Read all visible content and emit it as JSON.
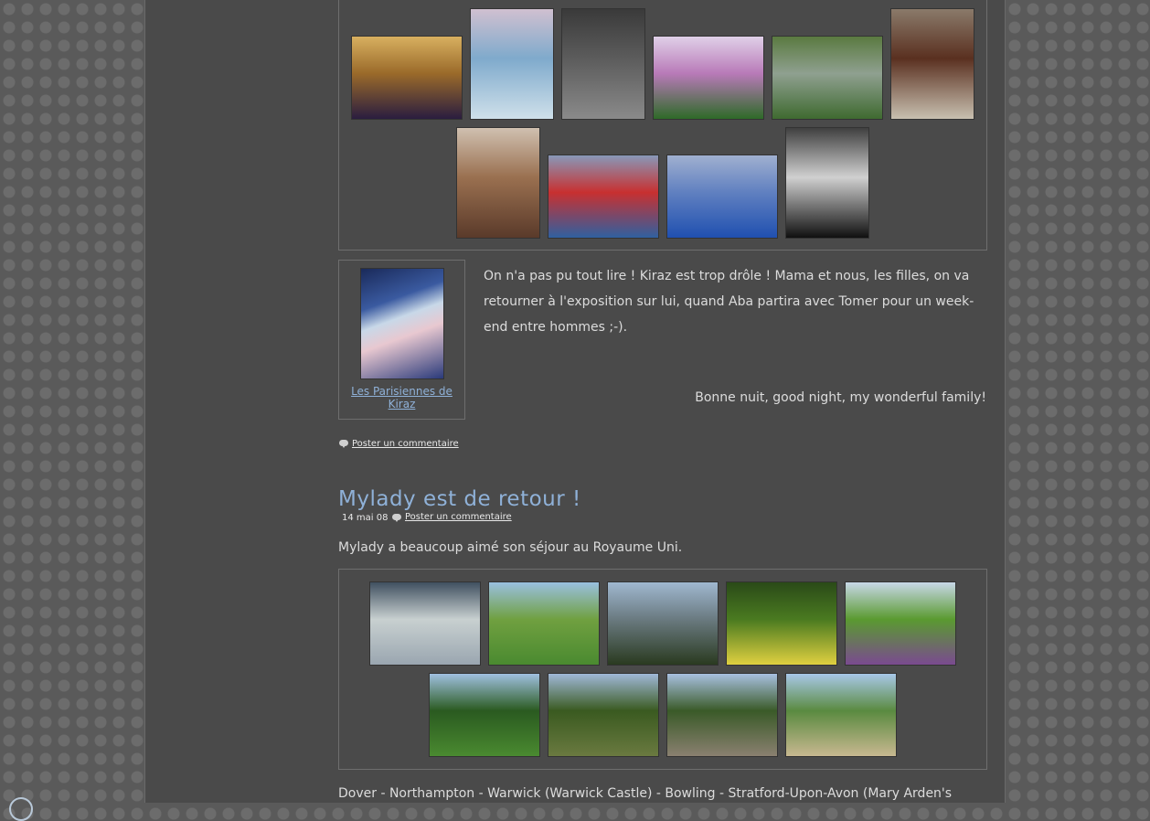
{
  "gallery1": {
    "row1": [
      {
        "name": "thumb-chateau-facade",
        "colors": [
          "#2a1d3f",
          "#9a6a2a",
          "#d8b060"
        ]
      },
      {
        "name": "thumb-kiraz-poster-bike",
        "colors": [
          "#cfe0ea",
          "#7faacc",
          "#d0c0d0"
        ]
      },
      {
        "name": "thumb-statue-courtyard",
        "colors": [
          "#8a8a8a",
          "#5c5c5c",
          "#3a3a3a"
        ]
      },
      {
        "name": "thumb-foxglove-garden",
        "colors": [
          "#2e6a28",
          "#b87ab8",
          "#e0d0e8"
        ]
      },
      {
        "name": "thumb-ivy-arcade",
        "colors": [
          "#3f6a30",
          "#8fa090",
          "#5a7a40"
        ]
      },
      {
        "name": "thumb-wooden-doors",
        "colors": [
          "#c8c0b0",
          "#5a3020",
          "#8a7a6a"
        ]
      }
    ],
    "row2": [
      {
        "name": "thumb-chocolate-figure",
        "colors": [
          "#5a3a2a",
          "#9a7050",
          "#d0c0b0"
        ]
      },
      {
        "name": "thumb-pompidou-pipes",
        "colors": [
          "#3060a0",
          "#c83030",
          "#8898b8"
        ]
      },
      {
        "name": "thumb-pompidou-escalator",
        "colors": [
          "#2050b0",
          "#6080c0",
          "#a0b0d0"
        ]
      },
      {
        "name": "thumb-bijoux-shop",
        "colors": [
          "#101010",
          "#d0d0d0",
          "#404040"
        ]
      }
    ]
  },
  "post1": {
    "image_caption": "Les Parisiennes de Kiraz",
    "paragraph": "On n'a pas pu tout lire ! Kiraz est trop drôle ! Mama et nous, les filles, on va retourner à l'exposition sur lui, quand Aba partira avec Tomer pour un week-end entre hommes ;-).",
    "signoff": "Bonne nuit, good night, my wonderful family!",
    "comment_label": "Poster un commentaire"
  },
  "post2": {
    "title": "Mylady est de retour !",
    "date": "14 mai 08",
    "comment_label": "Poster un commentaire",
    "intro": "Mylady a beaucoup aimé son séjour au Royaume Uni.",
    "places": "Dover - Northampton - Warwick (Warwick Castle) - Bowling - Stratford-Upon-Avon (Mary Arden's"
  },
  "gallery2": {
    "row1": [
      {
        "name": "thumb-dover-cliffs",
        "colors": [
          "#9aa6b0",
          "#c8d0d0",
          "#405060"
        ]
      },
      {
        "name": "thumb-pond-lawn",
        "colors": [
          "#4a8a30",
          "#70a040",
          "#9ac0e0"
        ]
      },
      {
        "name": "thumb-palace-topiary",
        "colors": [
          "#2a3a20",
          "#6a7a80",
          "#a0b8d0"
        ]
      },
      {
        "name": "thumb-yellow-flowers",
        "colors": [
          "#e0d040",
          "#4a7a20",
          "#2a4a18"
        ]
      },
      {
        "name": "thumb-purple-flowers",
        "colors": [
          "#7a4a90",
          "#5a9a30",
          "#c8d8e8"
        ]
      }
    ],
    "row2": [
      {
        "name": "thumb-formal-garden",
        "colors": [
          "#4a8a30",
          "#2a5a20",
          "#a0c0e0"
        ]
      },
      {
        "name": "thumb-parterre",
        "colors": [
          "#6a7a40",
          "#3a5a20",
          "#a0b8d8"
        ]
      },
      {
        "name": "thumb-gravel-avenue",
        "colors": [
          "#8a8070",
          "#3a5a28",
          "#a8c0e0"
        ]
      },
      {
        "name": "thumb-fountain",
        "colors": [
          "#c8b890",
          "#5a8a40",
          "#a8c8e8"
        ]
      }
    ]
  }
}
